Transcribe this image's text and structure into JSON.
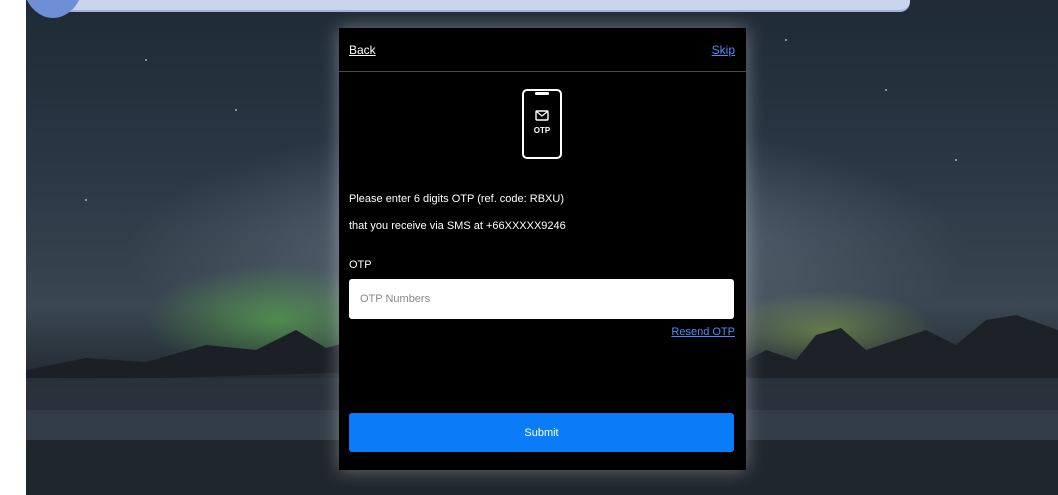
{
  "header": {
    "back_label": "Back",
    "skip_label": "Skip"
  },
  "icon": {
    "name": "phone-otp-icon",
    "text": "OTP"
  },
  "message": {
    "line1": "Please enter 6 digits OTP (ref. code: RBXU)",
    "line2": "that you receive via SMS at +66XXXXX9246"
  },
  "form": {
    "otp_label": "OTP",
    "otp_placeholder": "OTP Numbers",
    "otp_value": "",
    "resend_label": "Resend OTP",
    "submit_label": "Submit"
  },
  "colors": {
    "panel_bg": "#000000",
    "link": "#4d8ef5",
    "submit": "#0a7cf7",
    "banner": "#c9d4ef",
    "circle": "#6d8fd6"
  }
}
